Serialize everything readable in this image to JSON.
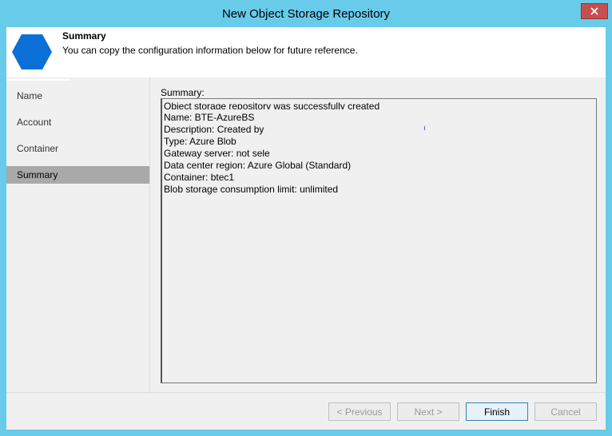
{
  "window": {
    "title": "New Object Storage Repository",
    "close_label": "✕"
  },
  "header": {
    "title": "Summary",
    "description": "You can copy the configuration information below for future reference.",
    "icon": "hexagon-icon",
    "icon_color": "#0a6fd6"
  },
  "sidebar": {
    "items": [
      {
        "label": "Name",
        "active": false
      },
      {
        "label": "Account",
        "active": false
      },
      {
        "label": "Container",
        "active": false
      },
      {
        "label": "Summary",
        "active": true
      }
    ]
  },
  "main": {
    "summary_label": "Summary:",
    "lines": [
      "Object storage repository was successfully created",
      "Name: BTE-AzureBS",
      "Description: Created by",
      "Type: Azure Blob",
      "Gateway server: not sele",
      "Data center region: Azure Global (Standard)",
      "Container: btec1",
      "Blob storage consumption limit: unlimited"
    ]
  },
  "buttons": {
    "previous": "< Previous",
    "next": "Next >",
    "finish": "Finish",
    "cancel": "Cancel"
  }
}
